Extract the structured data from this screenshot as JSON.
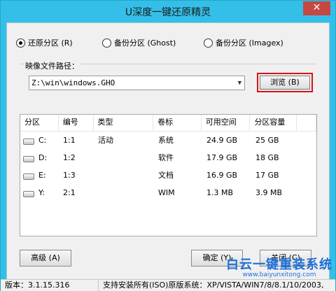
{
  "window": {
    "title": "U深度一键还原精灵",
    "close_glyph": "✕"
  },
  "mode": {
    "options": [
      {
        "label": "还原分区 (R)",
        "checked": true
      },
      {
        "label": "备份分区 (Ghost)",
        "checked": false
      },
      {
        "label": "备份分区 (Imagex)",
        "checked": false
      }
    ]
  },
  "image_path": {
    "label": "映像文件路径：",
    "value": "Z:\\win\\windows.GHO",
    "browse_label": "浏览 (B)"
  },
  "table": {
    "headers": [
      "分区",
      "编号",
      "类型",
      "卷标",
      "可用空间",
      "分区容量",
      ""
    ],
    "rows": [
      {
        "drive": "C:",
        "number": "1:1",
        "type": "活动",
        "label": "系统",
        "free": "24.9 GB",
        "capacity": "25 GB"
      },
      {
        "drive": "D:",
        "number": "1:2",
        "type": "",
        "label": "软件",
        "free": "17.9 GB",
        "capacity": "18 GB"
      },
      {
        "drive": "E:",
        "number": "1:3",
        "type": "",
        "label": "文档",
        "free": "16.9 GB",
        "capacity": "17 GB"
      },
      {
        "drive": "Y:",
        "number": "2:1",
        "type": "",
        "label": "WIM",
        "free": "1.3 MB",
        "capacity": "3.9 MB"
      }
    ],
    "drive_icon": "hard-drive-icon"
  },
  "buttons": {
    "advanced": "高级 (A)",
    "ok": "确定 (Y)",
    "close": "关闭 (C)"
  },
  "watermark": {
    "title": "白云一键重装系统",
    "url": "www.baiyunxitong.com"
  },
  "status": {
    "version": "版本：3.1.15.316",
    "support": "支持安装所有(ISO)原版系统：XP/VISTA/WIN7/8/8.1/10/2003,"
  },
  "colors": {
    "accent": "#33bfe8",
    "close": "#c74743",
    "highlight": "#d5141a",
    "watermark": "#1d6fd6"
  }
}
